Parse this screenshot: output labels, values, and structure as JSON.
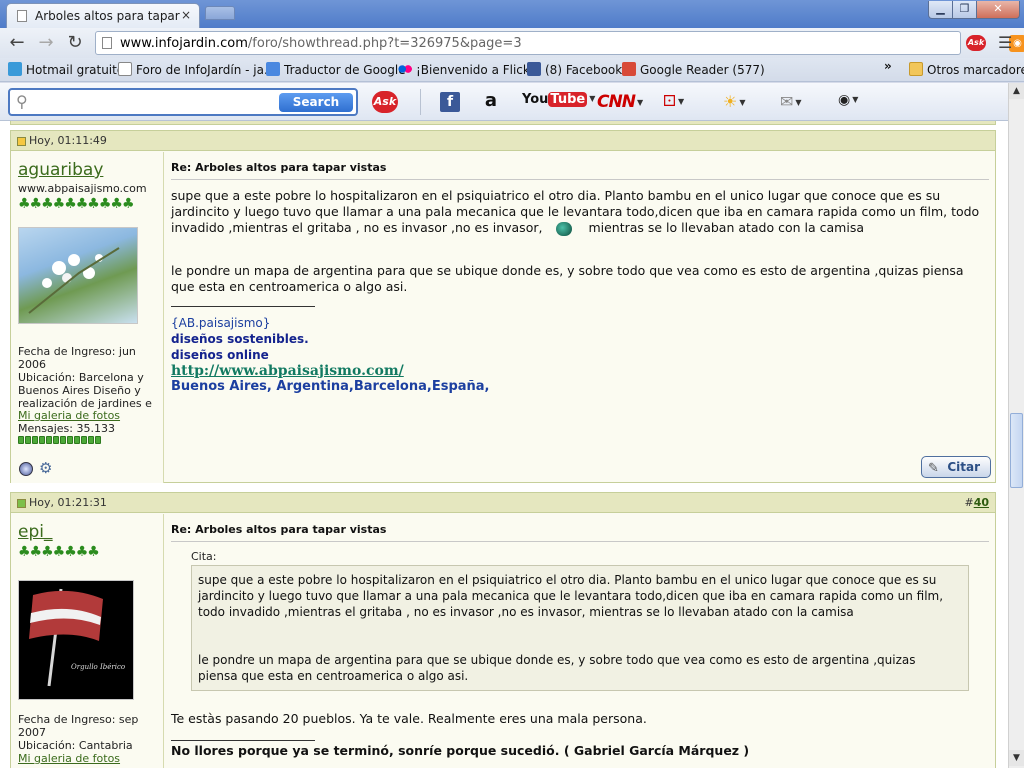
{
  "browser": {
    "tab_title": "Arboles altos para tapar vistas",
    "tab_close": "×",
    "url_host": "www.infojardin.com",
    "url_path": "/foro/showthread.php?t=326975&page=3",
    "win_min": "▁",
    "win_max": "❐",
    "win_close": "✕"
  },
  "bookmarks": [
    {
      "label": "Hotmail gratuito",
      "color": "#3a9ad9"
    },
    {
      "label": "Foro de InfoJardín - ja...",
      "color": "#ffffff"
    },
    {
      "label": "Traductor de Google",
      "color": "#4a88e0"
    },
    {
      "label": "¡Bienvenido a Flickr!",
      "color": "#ff0084"
    },
    {
      "label": "(8) Facebook",
      "color": "#3b5998"
    },
    {
      "label": "Google Reader (577)",
      "color": "#d84a38"
    }
  ],
  "bookmarks_more": "»",
  "bookmarks_other": "Otros marcadores",
  "asktoolbar": {
    "search_button": "Search",
    "search_placeholder": "",
    "ask_logo": "Ask",
    "fb": "f",
    "amazon": "a",
    "youtube_you": "You",
    "youtube_tube": "Tube",
    "cnn": "CNN"
  },
  "posts": [
    {
      "date": "Hoy, 01:11:49",
      "number": "",
      "username": "aguaribay",
      "user_site": "www.abpaisajismo.com",
      "clovers": "♣♣♣♣♣♣♣♣♣♣",
      "fecha_ingreso": "Fecha de Ingreso: jun 2006",
      "ubicacion": "Ubicación: Barcelona y Buenos Aires Diseño y realización de jardines e",
      "galeria": "Mi galeria de fotos",
      "mensajes": "Mensajes: 35.133",
      "title": "Re: Arboles altos para tapar vistas",
      "text1": "supe que a este pobre lo hospitalizaron en el psiquiatrico el otro dia. Planto bambu en el unico lugar que conoce que es su jardincito y luego tuvo que llamar a una pala mecanica que le levantara todo,dicen que iba en camara rapida como un film, todo invadido ,mientras el gritaba , no es invasor ,no es invasor,",
      "text1_end": "mientras se lo llevaban atado con la camisa",
      "text2": "le pondre un mapa de argentina para que se ubique donde es, y sobre todo que vea como es esto de argentina ,quizas piensa que esta en centroamerica o algo asi.",
      "sig_name": "{AB.paisajismo}",
      "sig_line1": "diseños sostenibles.",
      "sig_line2": "diseños online",
      "sig_link": "http://www.abpaisajismo.com/",
      "sig_cities": "Buenos Aires, Argentina,Barcelona,España,",
      "citar": "Citar"
    },
    {
      "date": "Hoy, 01:21:31",
      "number_prefix": "#",
      "number": "40",
      "username": "epi_",
      "clovers": "♣♣♣♣♣♣♣",
      "fecha_ingreso": "Fecha de Ingreso: sep 2007",
      "ubicacion": "Ubicación: Cantabria",
      "galeria": "Mi galeria de fotos",
      "avatar_caption": "Orgullo Ibérico",
      "title": "Re: Arboles altos para tapar vistas",
      "quote_label": "Cita:",
      "quote1": "supe que a este pobre lo hospitalizaron en el psiquiatrico el otro dia. Planto bambu en el unico lugar que conoce que es su jardincito y luego tuvo que llamar a una pala mecanica que le levantara todo,dicen que iba en camara rapida como un film, todo invadido ,mientras el gritaba , no es invasor ,no es invasor, mientras se lo llevaban atado con la camisa",
      "quote2": "le pondre un mapa de argentina para que se ubique donde es, y sobre todo que vea como es esto de argentina ,quizas piensa que esta en centroamerica o algo asi.",
      "reply": "Te estàs pasando 20 pueblos. Ya te vale. Realmente eres una mala persona.",
      "signature": "No llores porque ya se terminó, sonríe porque sucedió. ( Gabriel García Márquez )"
    }
  ]
}
